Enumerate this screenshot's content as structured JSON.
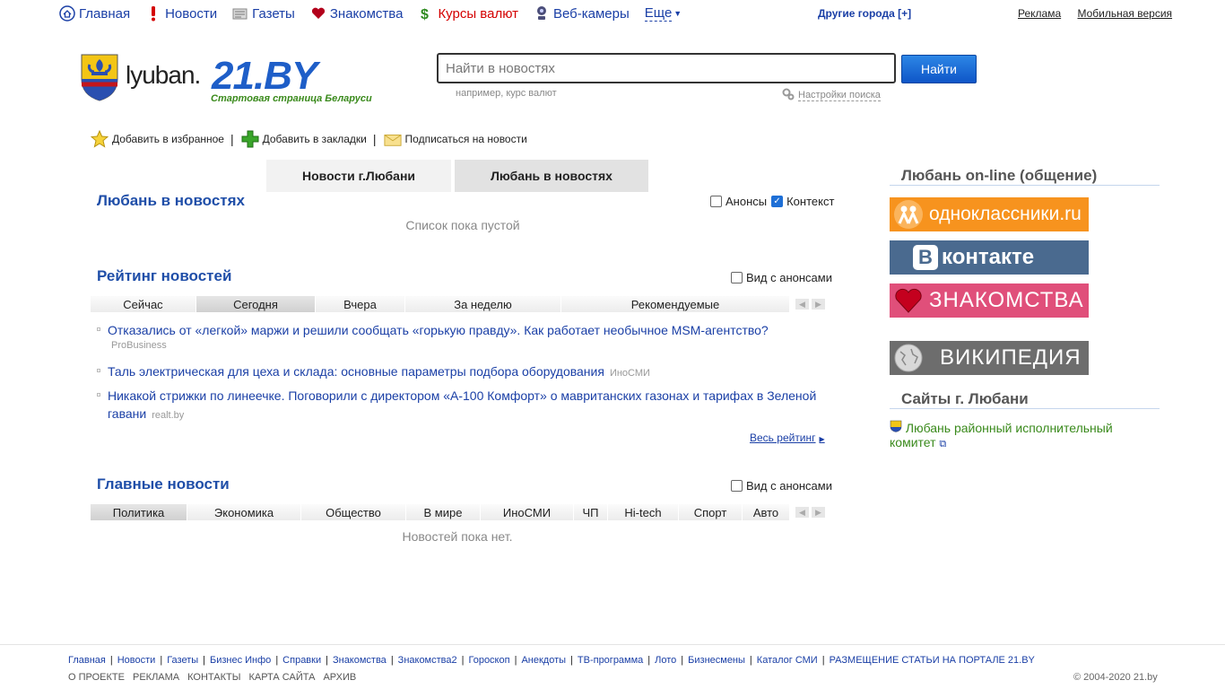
{
  "topnav": {
    "items": [
      {
        "label": "Главная",
        "icon": "home-icon"
      },
      {
        "label": "Новости",
        "icon": "exclamation-icon"
      },
      {
        "label": "Газеты",
        "icon": "newspaper-icon"
      },
      {
        "label": "Знакомства",
        "icon": "heart-icon"
      },
      {
        "label": "Курсы валют",
        "icon": "dollar-icon"
      },
      {
        "label": "Веб-камеры",
        "icon": "webcam-icon"
      }
    ],
    "more": "Еще",
    "other_cities": "Другие города [+]",
    "ads": "Реклама",
    "mobile": "Мобильная версия"
  },
  "header": {
    "city": "lyuban.",
    "brand": "21.BY",
    "tagline": "Стартовая страница Беларуси"
  },
  "search": {
    "placeholder": "Найти в новостях",
    "button": "Найти",
    "hint": "например, курс валют",
    "settings": "Настройки поиска"
  },
  "toolbar": {
    "favorite": "Добавить в избранное",
    "bookmark": "Добавить в закладки",
    "subscribe": "Подписаться на новости"
  },
  "tabs": {
    "city_news": "Новости г.Любани",
    "in_news": "Любань в новостях"
  },
  "city_section": {
    "title": "Любань в новостях",
    "opt_announce": "Анонсы",
    "opt_context": "Контекст",
    "empty": "Список пока пустой"
  },
  "rating": {
    "title": "Рейтинг новостей",
    "view_option": "Вид с анонсами",
    "tabs": [
      "Сейчас",
      "Сегодня",
      "Вчера",
      "За неделю",
      "Рекомендуемые"
    ],
    "items": [
      {
        "text": "Отказались от «легкой» маржи и решили сообщать «горькую правду». Как работает необычное MSM-агентство?",
        "source": "ProBusiness"
      },
      {
        "text": "Таль электрическая для цеха и склада: основные параметры подбора оборудования",
        "source": "ИноСМИ"
      },
      {
        "text": "Никакой стрижки по линеечке. Поговорили с директором «А-100 Комфорт» о мавританских газонах и тарифах в Зеленой гавани",
        "source": "realt.by"
      }
    ],
    "all": "Весь рейтинг"
  },
  "main_news": {
    "title": "Главные новости",
    "view_option": "Вид с анонсами",
    "tabs": [
      "Политика",
      "Экономика",
      "Общество",
      "В мире",
      "ИноСМИ",
      "ЧП",
      "Hi-tech",
      "Спорт",
      "Авто"
    ],
    "empty": "Новостей пока нет."
  },
  "right": {
    "online_title": "Любань on-line (общение)",
    "banners": {
      "ok": "одноклассники.ru",
      "vk": "контакте",
      "vk_letter": "В",
      "dating": "ЗНАКОМСТВА",
      "wiki": "ВИКИПЕДИЯ"
    },
    "sites_title": "Сайты г. Любани",
    "site_link": "Любань районный исполнительный комитет"
  },
  "footer": {
    "links": [
      "Главная",
      "Новости",
      "Газеты",
      "Бизнес Инфо",
      "Справки",
      "Знакомства",
      "Знакомства2",
      "Гороскоп",
      "Анекдоты",
      "ТВ-программа",
      "Лото",
      "Бизнесмены",
      "Каталог СМИ",
      "РАЗМЕЩЕНИЕ СТАТЬИ НА ПОРТАЛЕ 21.BY"
    ],
    "links2": [
      "О ПРОЕКТЕ",
      "РЕКЛАМА",
      "КОНТАКТЫ",
      "КАРТА САЙТА",
      "АРХИВ"
    ],
    "copyright": "© 2004-2020 21.by"
  },
  "colors": {
    "link": "#1a3fa6",
    "section_title": "#1f4ea8",
    "brand_blue": "#1e5ec8",
    "tagline_green": "#3a8a1c",
    "accent_red": "#d40000"
  }
}
